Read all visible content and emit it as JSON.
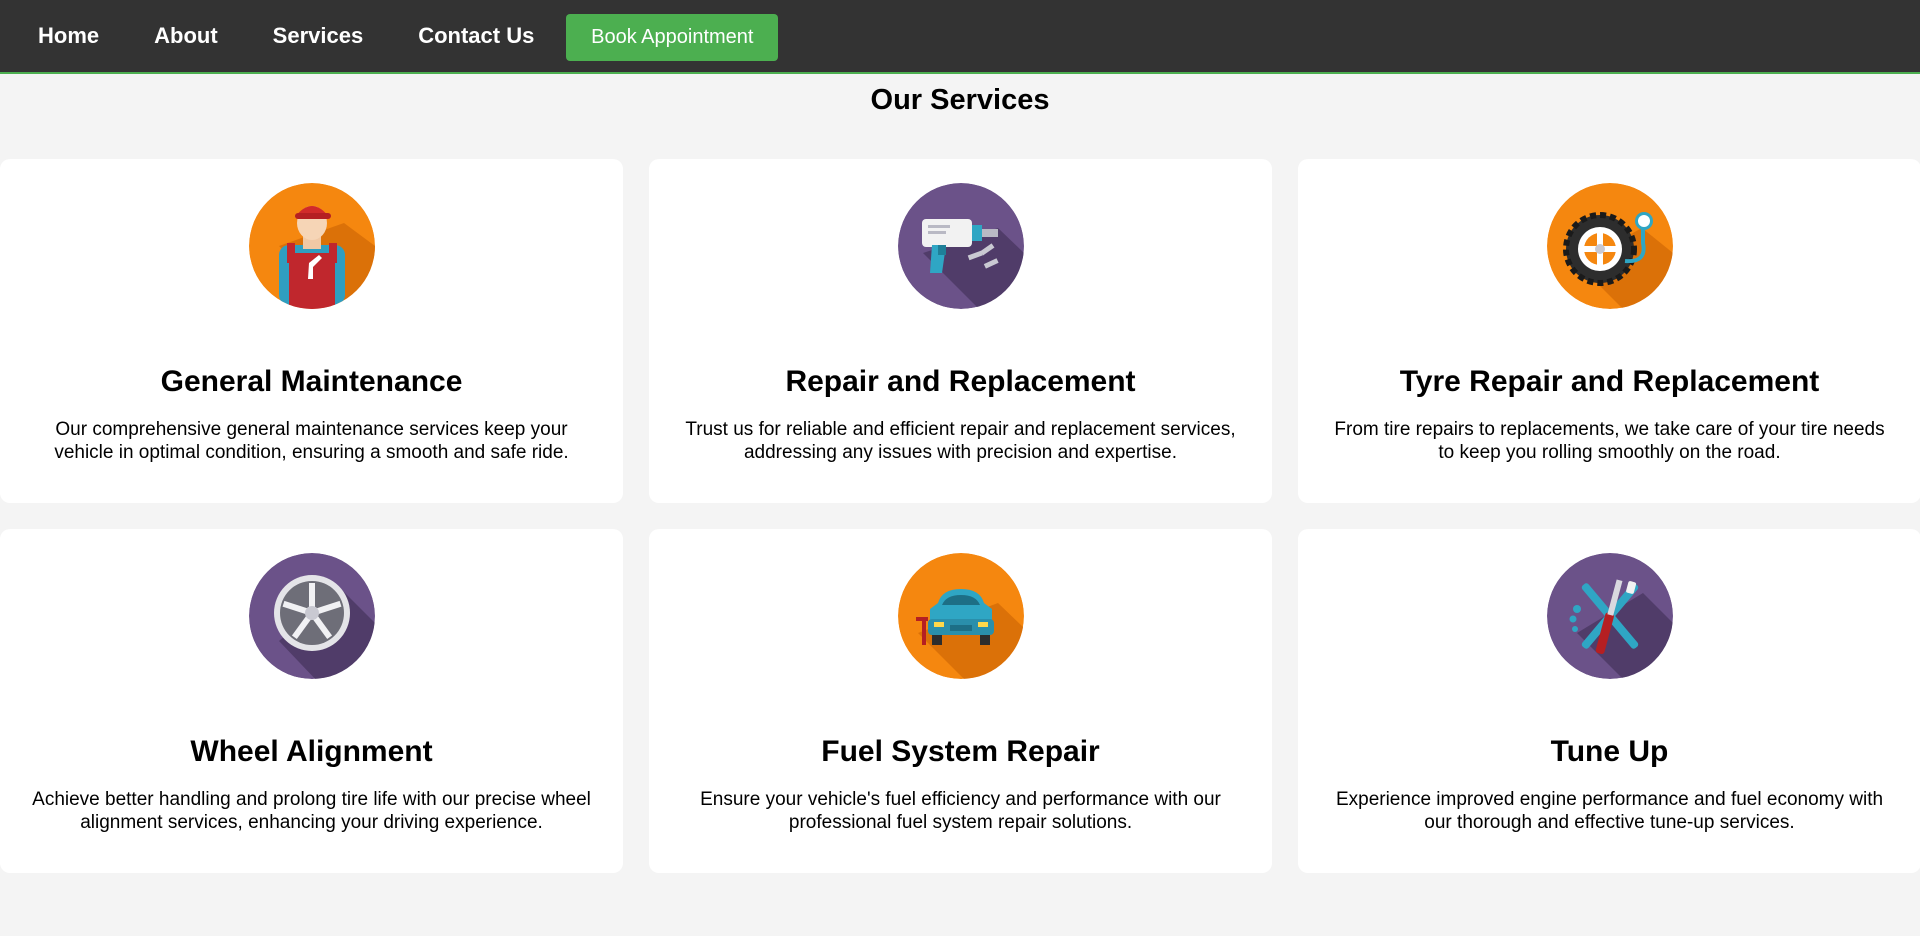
{
  "nav": {
    "links": [
      "Home",
      "About",
      "Services",
      "Contact Us"
    ],
    "book_button": "Book Appointment"
  },
  "colors": {
    "navbar": "#333333",
    "accent_green": "#4caf50",
    "icon_orange": "#f5870f",
    "icon_purple": "#6b5289",
    "card_bg": "#ffffff",
    "page_bg": "#f4f4f4"
  },
  "services": {
    "title": "Our Services",
    "items": [
      {
        "icon": "mechanic-icon",
        "title": "General Maintenance",
        "description": "Our comprehensive general maintenance services keep your vehicle in optimal condition, ensuring a smooth and safe ride."
      },
      {
        "icon": "impact-drill-icon",
        "title": "Repair and Replacement",
        "description": "Trust us for reliable and efficient repair and replacement services, addressing any issues with precision and expertise."
      },
      {
        "icon": "tire-pressure-icon",
        "title": "Tyre Repair and Replacement",
        "description": "From tire repairs to replacements, we take care of your tire needs to keep you rolling smoothly on the road."
      },
      {
        "icon": "alloy-wheel-icon",
        "title": "Wheel Alignment",
        "description": "Achieve better handling and prolong tire life with our precise wheel alignment services, enhancing your driving experience."
      },
      {
        "icon": "car-lift-icon",
        "title": "Fuel System Repair",
        "description": "Ensure your vehicle's fuel efficiency and performance with our professional fuel system repair solutions."
      },
      {
        "icon": "crossed-tools-icon",
        "title": "Tune Up",
        "description": "Experience improved engine performance and fuel economy with our thorough and effective tune-up services."
      }
    ]
  }
}
